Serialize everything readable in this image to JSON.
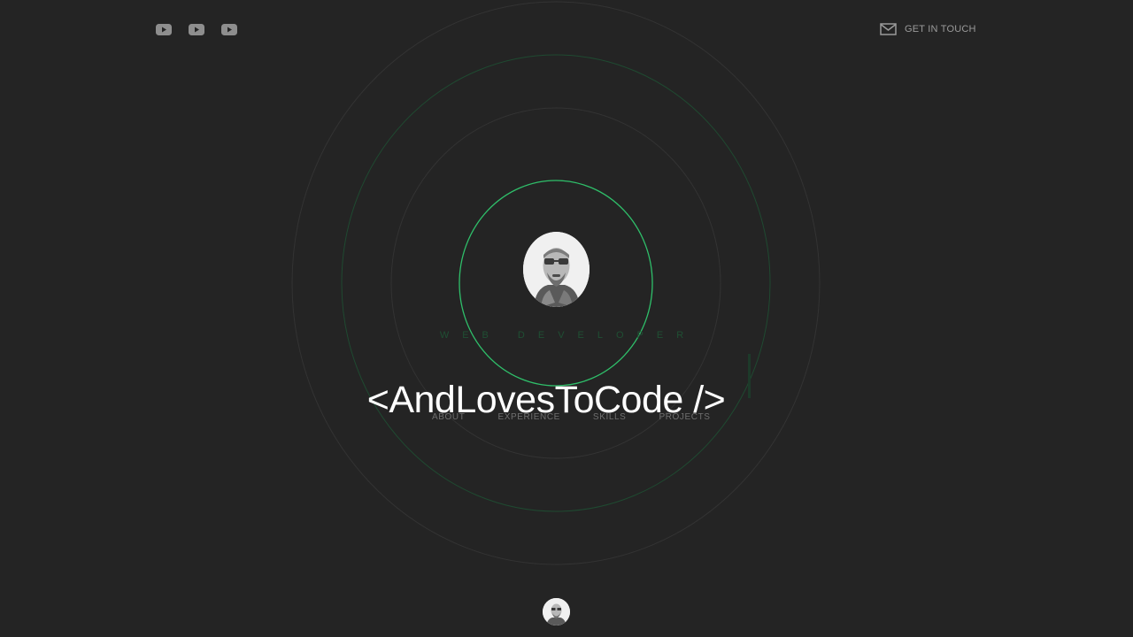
{
  "social": [
    {
      "icon": "youtube-icon"
    },
    {
      "icon": "youtube-icon"
    },
    {
      "icon": "youtube-icon"
    }
  ],
  "contact": {
    "icon": "mail-icon",
    "label": "GET IN TOUCH"
  },
  "hero": {
    "subtitle": "WEB DEVELOPER",
    "headline": "<AndLovesToCode />"
  },
  "nav": [
    {
      "label": "ABOUT"
    },
    {
      "label": "EXPERIENCE"
    },
    {
      "label": "SKILLS"
    },
    {
      "label": "PROJECTS"
    }
  ],
  "colors": {
    "background": "#242424",
    "accent": "#2fbf6a",
    "ring": "#3a3a3a",
    "text": "#ffffff",
    "muted": "#9a9a9a"
  }
}
